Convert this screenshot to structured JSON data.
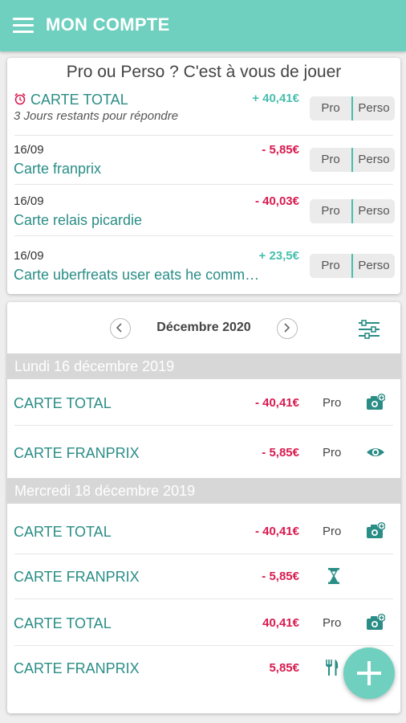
{
  "appbar": {
    "title": "MON COMPTE"
  },
  "pending": {
    "title": "Pro ou Perso ? C'est à vous de jouer",
    "items": [
      {
        "name": "CARTE TOTAL",
        "amount": "+ 40,41€",
        "remaining": "3 Jours restants pour répondre"
      },
      {
        "date": "16/09",
        "name": "Carte franprix",
        "amount": "- 5,85€"
      },
      {
        "date": "16/09",
        "name": "Carte relais picardie",
        "amount": "- 40,03€"
      },
      {
        "date": "16/09",
        "name": "Carte uberfreats user eats he comm…",
        "amount": "+ 23,5€"
      }
    ],
    "toggle": {
      "pro": "Pro",
      "perso": "Perso"
    }
  },
  "history": {
    "month": "Décembre 2020",
    "days": [
      {
        "label": "Lundi 16 décembre 2019",
        "transactions": [
          {
            "name": "CARTE TOTAL",
            "amount": "- 40,41€",
            "tag": "Pro",
            "icon": "camera-add-icon"
          },
          {
            "name": "CARTE FRANPRIX",
            "amount": "- 5,85€",
            "tag": "Pro",
            "icon": "eye-icon"
          }
        ]
      },
      {
        "label": "Mercredi 18 décembre 2019",
        "transactions": [
          {
            "name": "CARTE TOTAL",
            "amount": "- 40,41€",
            "tag": "Pro",
            "icon": "camera-add-icon"
          },
          {
            "name": "CARTE FRANPRIX",
            "amount": "- 5,85€",
            "tag": "",
            "icon": "hourglass-icon"
          },
          {
            "name": "CARTE TOTAL",
            "amount": "40,41€",
            "tag": "Pro",
            "icon": "camera-add-icon"
          },
          {
            "name": "CARTE FRANPRIX",
            "amount": "5,85€",
            "tag": "",
            "icon": "fork-knife-icon"
          }
        ]
      }
    ]
  },
  "colors": {
    "accent": "#6fd0bf",
    "teal_text": "#2a8d86",
    "negative": "#d81b4f",
    "positive": "#49bfae"
  }
}
